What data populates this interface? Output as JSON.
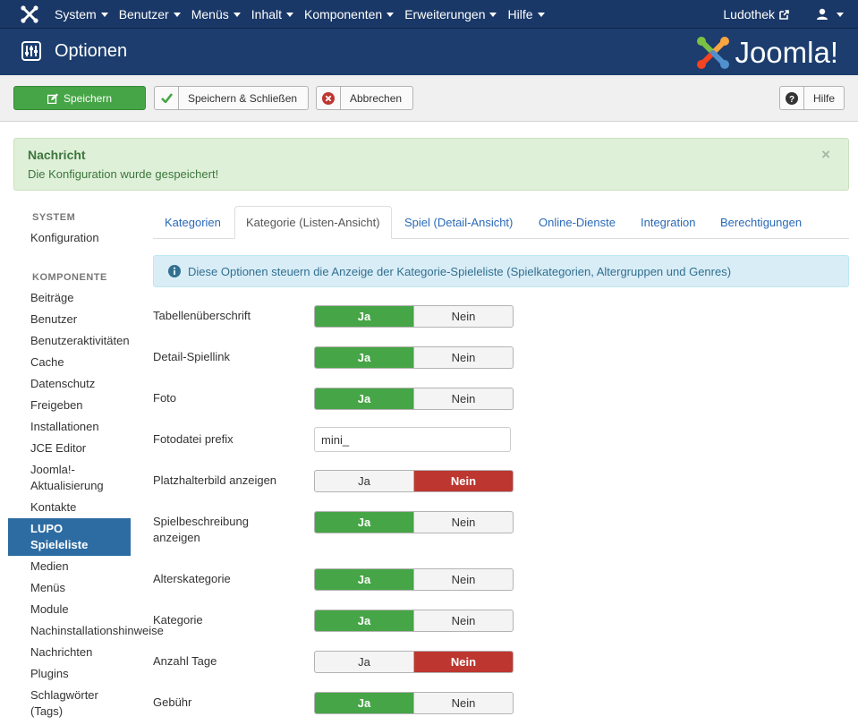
{
  "navbar": {
    "menu": [
      "System",
      "Benutzer",
      "Menüs",
      "Inhalt",
      "Komponenten",
      "Erweiterungen",
      "Hilfe"
    ],
    "site_name": "Ludothek"
  },
  "header": {
    "title": "Optionen",
    "brand": "Joomla!"
  },
  "toolbar": {
    "save_label": "Speichern",
    "save_close_label": "Speichern & Schließen",
    "cancel_label": "Abbrechen",
    "help_label": "Hilfe"
  },
  "alert": {
    "heading": "Nachricht",
    "message": "Die Konfiguration wurde gespeichert!",
    "close": "×"
  },
  "sidebar": {
    "system_heading": "SYSTEM",
    "system_items": [
      "Konfiguration"
    ],
    "component_heading": "KOMPONENTE",
    "component_items": [
      "Beiträge",
      "Benutzer",
      "Benutzeraktivitäten",
      "Cache",
      "Datenschutz",
      "Freigeben",
      "Installationen",
      "JCE Editor",
      "Joomla!-",
      "Aktualisierung",
      "Kontakte",
      "LUPO",
      "Spieleliste",
      "Medien",
      "Menüs",
      "Module",
      "Nachinstallationshinweise",
      "Nachrichten",
      "Plugins",
      "Schlagwörter",
      "(Tags)"
    ]
  },
  "tabs": [
    "Kategorien",
    "Kategorie (Listen-Ansicht)",
    "Spiel (Detail-Ansicht)",
    "Online-Dienste",
    "Integration",
    "Berechtigungen"
  ],
  "info": "Diese Optionen steuern die Anzeige der Kategorie-Spieleliste (Spielkategorien, Altergruppen und Genres)",
  "options": {
    "yes": "Ja",
    "no": "Nein",
    "rows": [
      {
        "label": "Tabellenüberschrift",
        "value": "Ja"
      },
      {
        "label": "Detail-Spiellink",
        "value": "Ja"
      },
      {
        "label": "Foto",
        "value": "Ja"
      },
      {
        "label": "Fotodatei prefix",
        "input_value": "mini_"
      },
      {
        "label": "Platzhalterbild anzeigen",
        "value": "Nein"
      },
      {
        "label": "Spielbeschreibung",
        "label_line2": "anzeigen",
        "value": "Ja"
      },
      {
        "label": "Alterskategorie",
        "value": "Ja"
      },
      {
        "label": "Kategorie",
        "value": "Ja"
      },
      {
        "label": "Anzahl Tage",
        "value": "Nein"
      },
      {
        "label": "Gebühr",
        "value": "Ja"
      }
    ]
  },
  "colors": {
    "navbar": "#1a3867",
    "header": "#1c3d6e",
    "success": "#46a546",
    "danger": "#bd362f",
    "link": "#2a69b8",
    "sidebar_active": "#2d6ca2"
  }
}
